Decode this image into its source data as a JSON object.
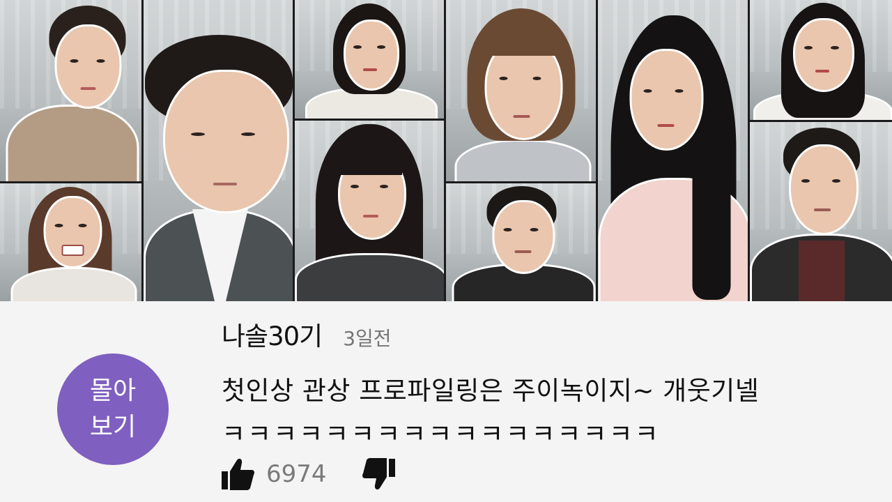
{
  "thumbnail": {
    "description_tiles": 10,
    "portraits": [
      {
        "id": "man-plaid",
        "hair": "#2a211c",
        "top": "#b49b84"
      },
      {
        "id": "woman-laughing",
        "hair": "#5a3a2a",
        "top": "#e8e4e0"
      },
      {
        "id": "man-large",
        "hair": "#1f1a18",
        "top": "#4c5154"
      },
      {
        "id": "woman-bob",
        "hair": "#1b1614",
        "top": "#ece8e2"
      },
      {
        "id": "woman-bangs",
        "hair": "#1c1716",
        "top": "#3b3d3f"
      },
      {
        "id": "woman-short",
        "hair": "#6b4a33",
        "top": "#bfc3c7"
      },
      {
        "id": "man-smirk",
        "hair": "#1c1816",
        "top": "#262626"
      },
      {
        "id": "woman-long",
        "hair": "#141212",
        "top": "#f2d3cd"
      },
      {
        "id": "woman-top-right",
        "hair": "#161312",
        "top": "#f1efeb"
      },
      {
        "id": "man-bottom-right",
        "hair": "#1e1a18",
        "top": "#2b2b2b"
      }
    ]
  },
  "badge": {
    "line1": "몰아",
    "line2": "보기",
    "color": "#7f5fbf"
  },
  "video": {
    "channel": "나솔30기",
    "time_ago": "3일전",
    "title_line1": "첫인상 관상 프로파일링은 주이녹이지~ 개웃기넬",
    "title_line2": "ㅋㅋㅋㅋㅋㅋㅋㅋㅋㅋㅋㅋㅋㅋㅋㅋㅋ",
    "like_count": "6974"
  },
  "icons": {
    "like": "thumbs-up-icon",
    "dislike": "thumbs-down-icon"
  }
}
